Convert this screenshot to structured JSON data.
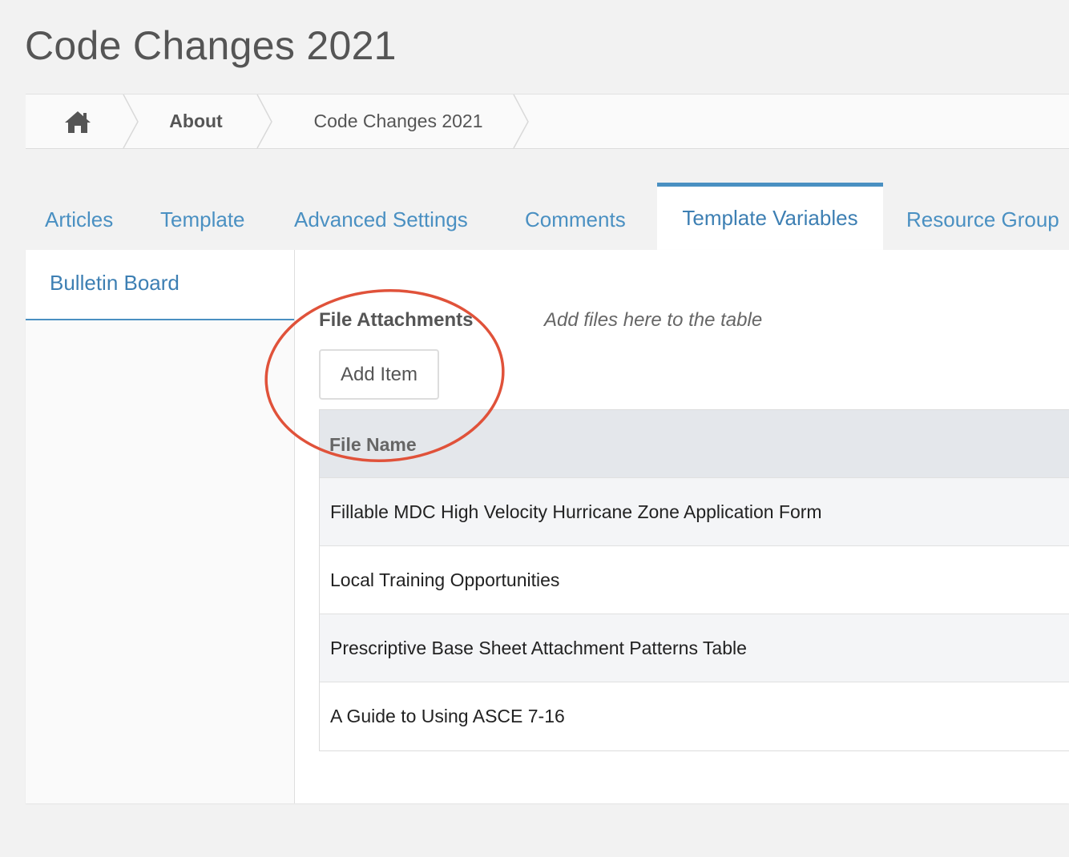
{
  "page": {
    "title": "Code Changes 2021"
  },
  "breadcrumb": {
    "home_icon": "home-icon",
    "items": [
      "About",
      "Code Changes 2021"
    ]
  },
  "tabs": [
    {
      "label": "Articles"
    },
    {
      "label": "Template"
    },
    {
      "label": "Advanced Settings"
    },
    {
      "label": "Comments"
    },
    {
      "label": "Template Variables",
      "active": true
    },
    {
      "label": "Resource Group"
    }
  ],
  "sidebar": {
    "items": [
      {
        "label": "Bulletin Board",
        "active": true
      }
    ]
  },
  "field": {
    "label": "File Attachments",
    "description": "Add files here to the table",
    "add_button": "Add Item"
  },
  "table": {
    "columns": [
      "File Name"
    ],
    "rows": [
      "Fillable MDC High Velocity Hurricane Zone Application Form",
      "Local Training Opportunities",
      "Prescriptive Base Sheet Attachment Patterns Table",
      "A Guide to Using ASCE 7-16"
    ]
  },
  "colors": {
    "accent": "#4a90c2",
    "annotation_ring": "#e0523a",
    "background": "#f2f2f2"
  }
}
